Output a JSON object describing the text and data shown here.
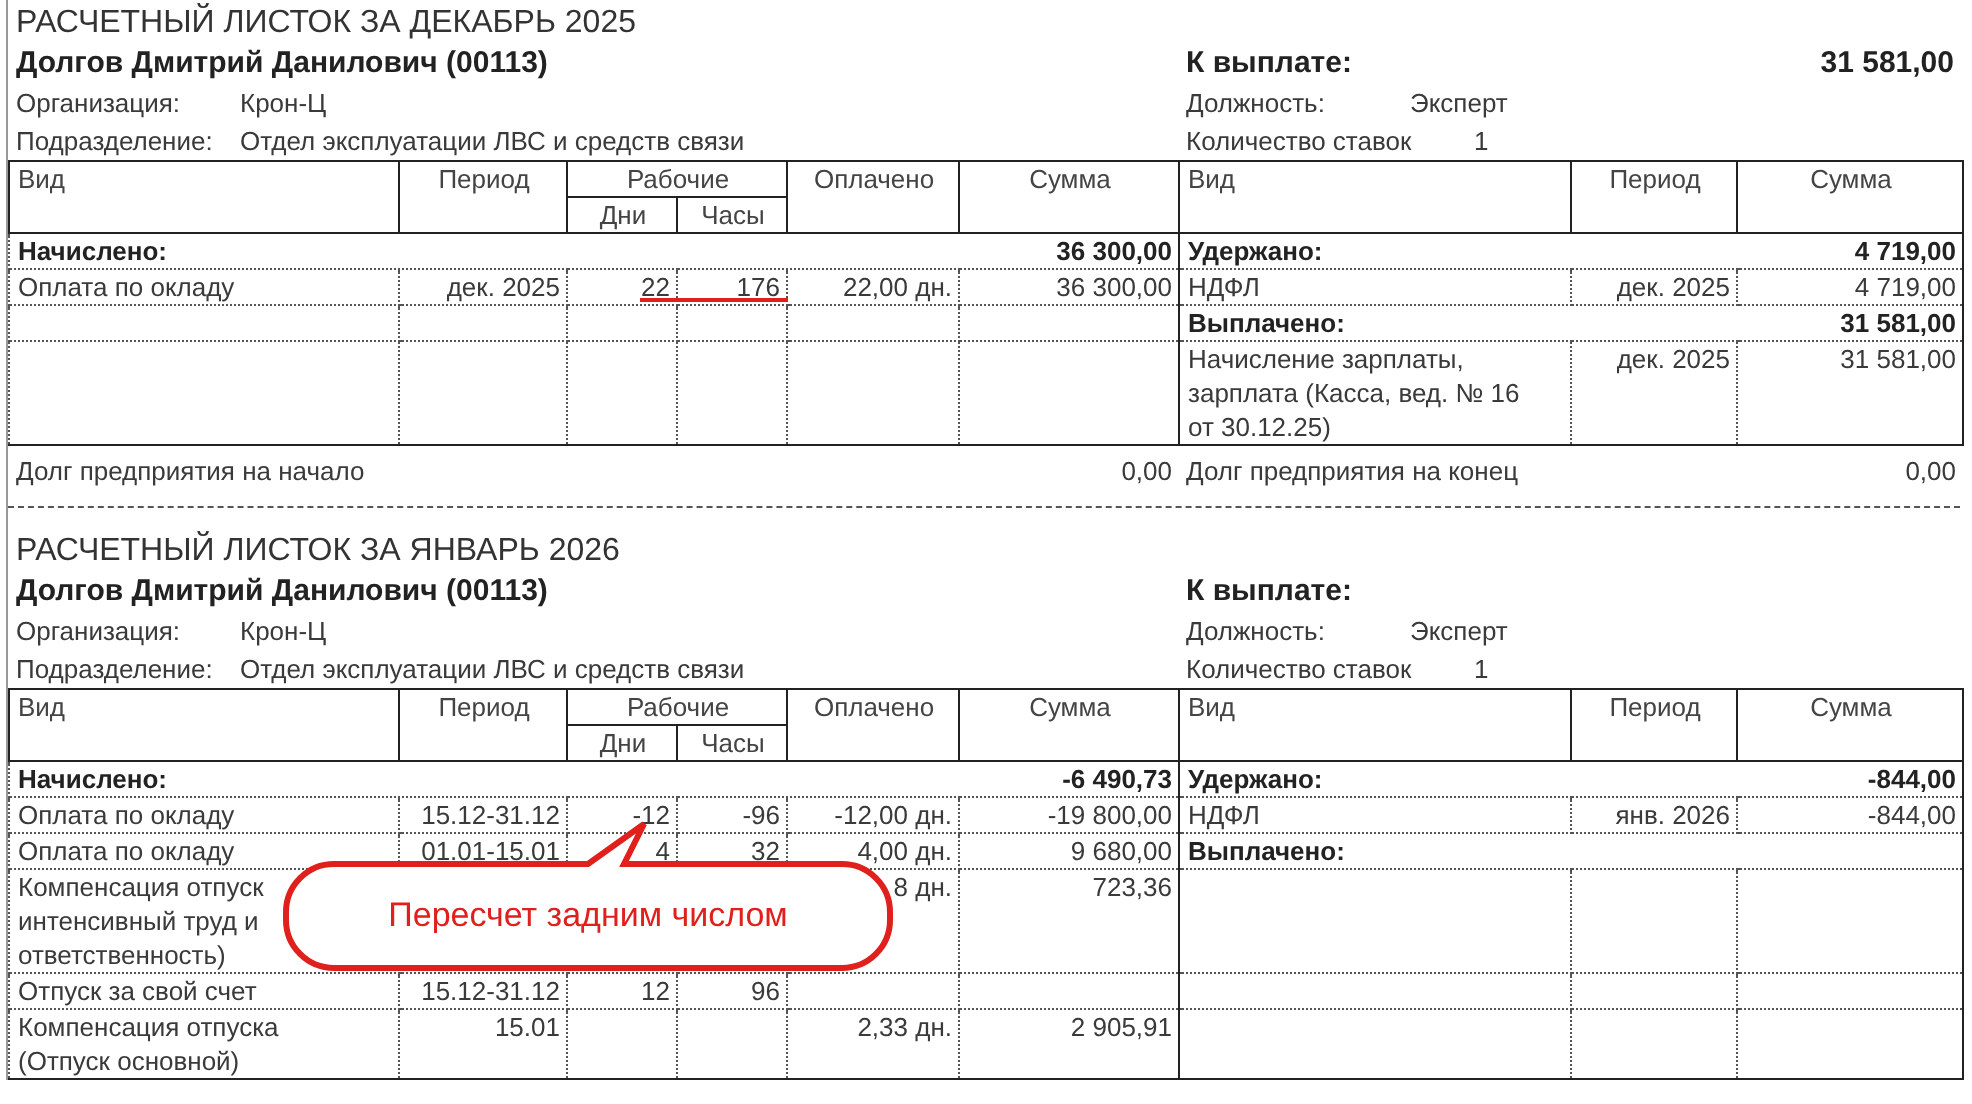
{
  "payslips": [
    {
      "title": "РАСЧЕТНЫЙ ЛИСТОК ЗА ДЕКАБРЬ 2025",
      "employee": "Долгов Дмитрий Данилович (00113)",
      "to_pay": {
        "label": "К выплате:",
        "amount": "31 581,00"
      },
      "info_left": [
        {
          "label": "Организация:",
          "value": "Крон-Ц"
        },
        {
          "label": "Подразделение:",
          "value": "Отдел эксплуатации ЛВС и средств связи"
        }
      ],
      "info_right": [
        {
          "label": "Должность:",
          "value": "Эксперт"
        },
        {
          "label": "Количество ставок",
          "value": "1"
        }
      ],
      "left_columns": {
        "type": "Вид",
        "period": "Период",
        "working": "Рабочие",
        "days": "Дни",
        "hours": "Часы",
        "paid": "Оплачено",
        "sum": "Сумма"
      },
      "right_columns": {
        "type": "Вид",
        "period": "Период",
        "sum": "Сумма"
      },
      "rows": [
        {
          "left": {
            "kind": "section",
            "label": "Начислено:",
            "sum": "36 300,00"
          },
          "right": {
            "kind": "section",
            "label": "Удержано:",
            "sum": "4 719,00"
          }
        },
        {
          "left": {
            "kind": "item",
            "type": "Оплата по окладу",
            "period": "дек. 2025",
            "days": "22",
            "hours": "176",
            "paid": "22,00 дн.",
            "sum": "36 300,00",
            "marked": true
          },
          "right": {
            "kind": "item",
            "type": "НДФЛ",
            "period": "дек. 2025",
            "sum": "4 719,00"
          }
        },
        {
          "left": {
            "kind": "empty"
          },
          "right": {
            "kind": "section",
            "label": "Выплачено:",
            "sum": "31 581,00"
          }
        },
        {
          "left": {
            "kind": "empty"
          },
          "right": {
            "kind": "item",
            "type": "Начисление зарплаты,\nзарплата (Касса, вед. № 16\nот 30.12.25)",
            "period": "дек. 2025",
            "sum": "31 581,00"
          }
        }
      ],
      "debt_start": {
        "label": "Долг предприятия на начало",
        "value": "0,00"
      },
      "debt_end": {
        "label": "Долг предприятия на конец",
        "value": "0,00"
      }
    },
    {
      "title": "РАСЧЕТНЫЙ ЛИСТОК ЗА ЯНВАРЬ 2026",
      "employee": "Долгов Дмитрий Данилович (00113)",
      "to_pay": {
        "label": "К выплате:"
      },
      "info_left": [
        {
          "label": "Организация:",
          "value": "Крон-Ц"
        },
        {
          "label": "Подразделение:",
          "value": "Отдел эксплуатации ЛВС и средств связи"
        }
      ],
      "info_right": [
        {
          "label": "Должность:",
          "value": "Эксперт"
        },
        {
          "label": "Количество ставок",
          "value": "1"
        }
      ],
      "left_columns": {
        "type": "Вид",
        "period": "Период",
        "working": "Рабочие",
        "days": "Дни",
        "hours": "Часы",
        "paid": "Оплачено",
        "sum": "Сумма"
      },
      "right_columns": {
        "type": "Вид",
        "period": "Период",
        "sum": "Сумма"
      },
      "rows": [
        {
          "left": {
            "kind": "section",
            "label": "Начислено:",
            "sum": "-6 490,73"
          },
          "right": {
            "kind": "section",
            "label": "Удержано:",
            "sum": "-844,00"
          }
        },
        {
          "left": {
            "kind": "item",
            "type": "Оплата по окладу",
            "period": "15.12-31.12",
            "days": "-12",
            "hours": "-96",
            "paid": "-12,00 дн.",
            "sum": "-19 800,00",
            "marked": false
          },
          "right": {
            "kind": "item",
            "type": "НДФЛ",
            "period": "янв. 2026",
            "sum": "-844,00"
          }
        },
        {
          "left": {
            "kind": "item",
            "type": "Оплата по окладу",
            "period": "01.01-15.01",
            "days": "4",
            "hours": "32",
            "paid": "4,00 дн.",
            "sum": "9 680,00",
            "marked": false
          },
          "right": {
            "kind": "section",
            "label": "Выплачено:"
          }
        },
        {
          "left": {
            "kind": "item",
            "type": "Компенсация отпуск\nинтенсивный труд и\nответственность)",
            "paid": "8 дн.",
            "sum": "723,36",
            "marked": false
          },
          "right": {
            "kind": "empty"
          }
        },
        {
          "left": {
            "kind": "item",
            "type": "Отпуск за свой счет",
            "period": "15.12-31.12",
            "days": "12",
            "hours": "96",
            "marked": false
          },
          "right": {
            "kind": "empty"
          }
        },
        {
          "left": {
            "kind": "item",
            "type": "Компенсация отпуска\n(Отпуск основной)",
            "period": "15.01",
            "paid": "2,33 дн.",
            "sum": "2 905,91",
            "marked": false
          },
          "right": {
            "kind": "empty"
          }
        }
      ],
      "callout": {
        "text": "Пересчет задним числом"
      }
    }
  ]
}
